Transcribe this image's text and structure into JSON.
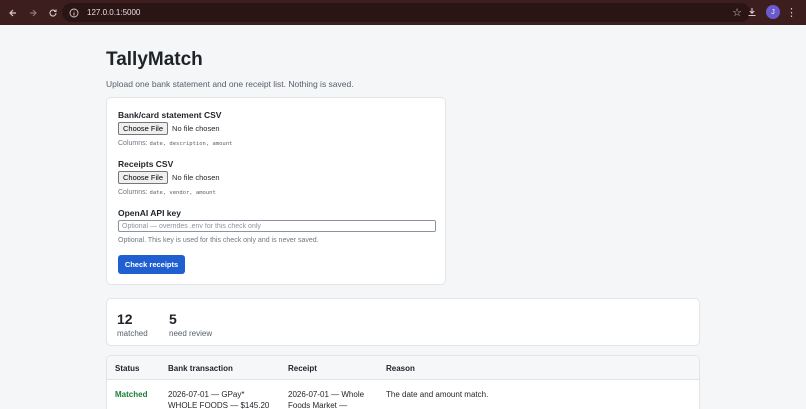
{
  "browser": {
    "url": "127.0.0.1:5000",
    "avatar_initial": "J",
    "icons": {
      "back": "arrow-left",
      "forward": "arrow-right",
      "reload": "refresh",
      "site_info": "info",
      "bookmark": "star",
      "download": "download",
      "menu": "more-vert"
    }
  },
  "app": {
    "title": "TallyMatch",
    "subtitle": "Upload one bank statement and one receipt list. Nothing is saved."
  },
  "form": {
    "bank": {
      "label": "Bank/card statement CSV",
      "button": "Choose File",
      "status": "No file chosen",
      "columns_prefix": "Columns:",
      "columns": "date, description, amount"
    },
    "receipts": {
      "label": "Receipts CSV",
      "button": "Choose File",
      "status": "No file chosen",
      "columns_prefix": "Columns:",
      "columns": "date, vendor, amount"
    },
    "api": {
      "label": "OpenAI API key",
      "placeholder": "Optional — overrides .env for this check only",
      "hint": "Optional. This key is used for this check only and is never saved."
    },
    "submit_label": "Check receipts"
  },
  "stats": {
    "matched_count": "12",
    "matched_label": "matched",
    "review_count": "5",
    "review_label": "need review"
  },
  "results": {
    "headers": {
      "status": "Status",
      "bank": "Bank transaction",
      "receipt": "Receipt",
      "reason": "Reason"
    },
    "rows": [
      {
        "status": "Matched",
        "bank_line1": "2026-07-01 — GPay*",
        "bank_line2": "WHOLE FOODS — $145.20",
        "receipt_line1": "2026-07-01 — Whole",
        "receipt_line2": "Foods Market —",
        "reason": "The date and amount match."
      }
    ]
  },
  "colors": {
    "accent": "#1f5fcf",
    "matched": "#1a7f37",
    "chrome": "#3c1e1e"
  }
}
